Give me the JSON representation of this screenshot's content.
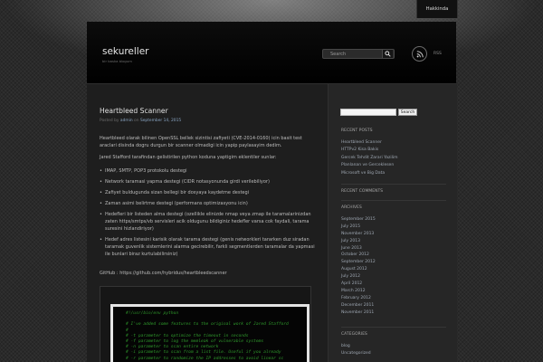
{
  "nav": {
    "about": "Hakkinda"
  },
  "header": {
    "site_title": "sekureller",
    "site_desc": "bir baska blogum",
    "search_placeholder": "Search",
    "rss_label": "RSS"
  },
  "post": {
    "title": "Heartbleed Scanner",
    "meta_prefix": "Posted by",
    "author": "admin",
    "meta_on": "on",
    "date": "September 14, 2015",
    "intro": "Heartbleed olarak bilinen OpenSSL bellek sizintisi zafiyeti (CVE-2014-0160) icin basit test araclari disinda dogru durgun bir scanner olmadigi icin yapip paylasayim dedim.",
    "intro2": "Jared Stafford tarafindan gelistirilen python koduna yaptigim eklentiler sunlar:",
    "bullets": [
      "IMAP, SMTP, POP3 protokolu destegi",
      "Network taramasi yapma destegi (CIDR notasyonunda girdi verilebiliyor)",
      "Zafiyet buldugunda sizan bellegi bir dosyaya kaydetme destegi",
      "Zaman asimi belirtme destegi (performans optimizasyonu icin)",
      "Hedefleri bir listeden alma destegi (ozellikle elinizde nmap veya zmap ile taramalarinizdan zaten https/smtps/vb servisleri acik oldugunu bildiginiz hedefler varsa cok faydali, tarama suresini hizlandiriyor)",
      "Hedef adres listesini karisik olarak tarama destegi (genis networkleri tararken duz siradan taramak guvenlik sistemlerini alarma gecirebilir, farkli segmentlerden taramalar da yapmasi ile bunlari biraz kurtulabilirsiniz)"
    ],
    "github": "GitHub : https://github.com/hybridus/heartbleedscanner",
    "code_lines": [
      "#!/usr/bin/env python",
      "",
      "# I've added some features to the original work of Jared Stafford",
      "#",
      "# -t parameter to optimize the timeout in seconds",
      "# -f parameter to log the memleak of vulnerable systems",
      "# -n parameter to scan entire network",
      "# -i parameter to scan from a list file. Useful if you already",
      "# -r parameter to randomize the IP addresses to avoid linear sc"
    ]
  },
  "sidebar": {
    "search_button": "Search",
    "recent_posts_heading": "RECENT POSTS",
    "recent_posts": [
      "Heartbleed Scanner",
      "HTTPv2 Kisa Bakis",
      "Gercek Tehdit Zarari Yazilim",
      "Planlanan ve Gerceklesen",
      "Microsoft ve Big Data"
    ],
    "recent_comments_heading": "RECENT COMMENTS",
    "archives_heading": "ARCHIVES",
    "archives": [
      "September 2015",
      "July 2015",
      "November 2013",
      "July 2013",
      "June 2013",
      "October 2012",
      "September 2012",
      "August 2012",
      "July 2012",
      "April 2012",
      "March 2012",
      "February 2012",
      "December 2011",
      "November 2011"
    ],
    "categories_heading": "CATEGORIES",
    "categories": [
      "blog",
      "Uncategorized"
    ]
  }
}
